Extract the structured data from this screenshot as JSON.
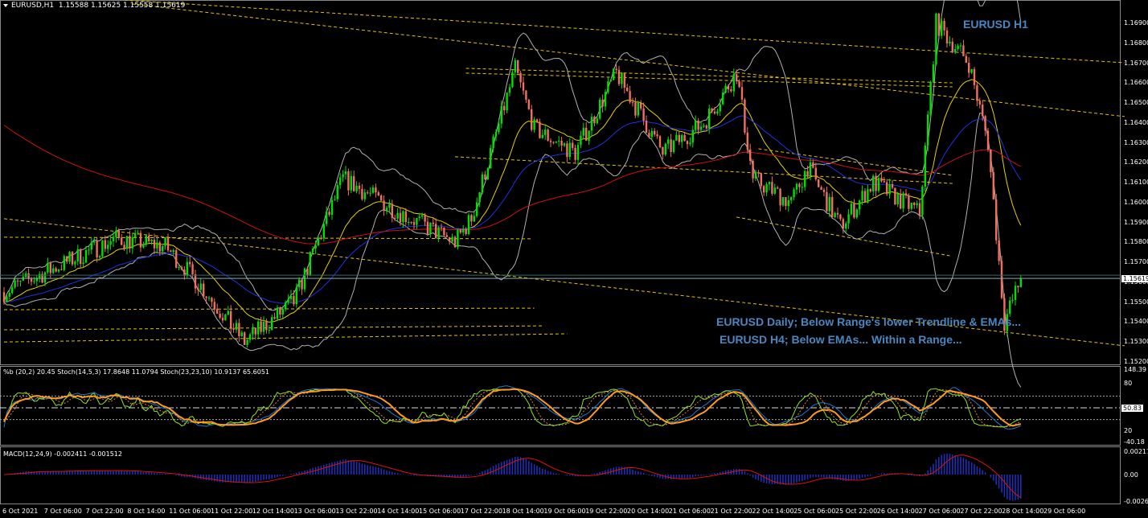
{
  "header": {
    "symbol": "EURUSD,H1",
    "open": "1.15588",
    "high": "1.15625",
    "low": "1.15558",
    "close": "1.15619"
  },
  "annotations": {
    "title": "EURUSD H1",
    "daily": "EURUSD Daily; Below Range's lower Trendline & EMAs...",
    "h4": "EURUSD H4; Below EMAs... Within a Range..."
  },
  "price_axis": [
    "1.16900",
    "1.16800",
    "1.16700",
    "1.16600",
    "1.16500",
    "1.16400",
    "1.16300",
    "1.16200",
    "1.16100",
    "1.16000",
    "1.15900",
    "1.15800",
    "1.15700",
    "1.15600",
    "1.15500",
    "1.15400",
    "1.15300",
    "1.15200"
  ],
  "current_price_tag": "1.15619",
  "stoch_pane": {
    "label": "%b (20,2) 20.45  Stoch(14,5,3) 17.8648 11.0794  Stoch(23,23,10) 10.9137 65.6051",
    "axis": [
      "148.39",
      "80",
      "50.83",
      "20",
      "-40.18"
    ]
  },
  "macd_pane": {
    "label": "MACD(12,24,9) -0.002411 -0.001512",
    "axis": [
      "0.002179",
      "0.00",
      "-0.00263"
    ]
  },
  "time_axis": [
    "6 Oct 2021",
    "7 Oct 06:00",
    "7 Oct 22:00",
    "8 Oct 14:00",
    "11 Oct 06:00",
    "11 Oct 22:00",
    "12 Oct 14:00",
    "13 Oct 06:00",
    "13 Oct 22:00",
    "14 Oct 14:00",
    "15 Oct 06:00",
    "17 Oct 22:00",
    "18 Oct 14:00",
    "19 Oct 06:00",
    "19 Oct 22:00",
    "20 Oct 14:00",
    "21 Oct 06:00",
    "21 Oct 22:00",
    "22 Oct 14:00",
    "25 Oct 06:00",
    "25 Oct 22:00",
    "26 Oct 14:00",
    "27 Oct 06:00",
    "27 Oct 22:00",
    "28 Oct 14:00",
    "29 Oct 06:00"
  ],
  "colors": {
    "bull": "#00e000",
    "bear": "#f07060",
    "trend": "#e6c200",
    "ema_fast": "#e6d000",
    "ema_mid": "#2030e0",
    "ema_slow": "#d01010",
    "bands": "#b0b0b0",
    "annotation": "#4a86c0"
  },
  "chart_data": {
    "type": "candlestick",
    "title": "EURUSD,H1",
    "ylim": [
      1.152,
      1.169
    ],
    "price_path": [
      [
        0,
        1.1555
      ],
      [
        41,
        1.1582
      ],
      [
        59,
        1.1578
      ],
      [
        71,
        1.156
      ],
      [
        88,
        1.153
      ],
      [
        106,
        1.155
      ],
      [
        124,
        1.1612
      ],
      [
        141,
        1.1598
      ],
      [
        165,
        1.158
      ],
      [
        171,
        1.1592
      ],
      [
        187,
        1.1667
      ],
      [
        194,
        1.1637
      ],
      [
        209,
        1.1625
      ],
      [
        224,
        1.1665
      ],
      [
        241,
        1.1625
      ],
      [
        256,
        1.164
      ],
      [
        268,
        1.1665
      ],
      [
        274,
        1.1612
      ],
      [
        288,
        1.16
      ],
      [
        294,
        1.1618
      ],
      [
        306,
        1.1588
      ],
      [
        318,
        1.161
      ],
      [
        335,
        1.1595
      ],
      [
        341,
        1.169
      ],
      [
        353,
        1.167
      ],
      [
        360,
        1.163
      ],
      [
        362,
        1.16
      ],
      [
        366,
        1.154
      ],
      [
        372,
        1.1562
      ]
    ],
    "last_close": 1.15619,
    "trendlines": [
      [
        [
          44,
          1.17017
        ],
        [
          410,
          1.16702
        ]
      ],
      [
        [
          47,
          1.16997
        ],
        [
          410,
          1.16432
        ]
      ],
      [
        [
          0,
          1.15919
        ],
        [
          410,
          1.15281
        ]
      ],
      [
        [
          169,
          1.16674
        ],
        [
          347,
          1.16601
        ]
      ],
      [
        [
          169,
          1.1665
        ],
        [
          347,
          1.16581
        ]
      ],
      [
        [
          165,
          1.1623
        ],
        [
          347,
          1.16096
        ]
      ],
      [
        [
          268,
          1.15927
        ],
        [
          346,
          1.15733
        ]
      ],
      [
        [
          276,
          1.1627
        ],
        [
          347,
          1.16137
        ]
      ],
      [
        [
          0,
          1.15826
        ],
        [
          193,
          1.15818
        ]
      ],
      [
        [
          0,
          1.15462
        ],
        [
          194,
          1.1547
        ]
      ],
      [
        [
          0,
          1.15361
        ],
        [
          197,
          1.15381
        ]
      ],
      [
        [
          0,
          1.153
        ],
        [
          206,
          1.15341
        ]
      ]
    ]
  }
}
